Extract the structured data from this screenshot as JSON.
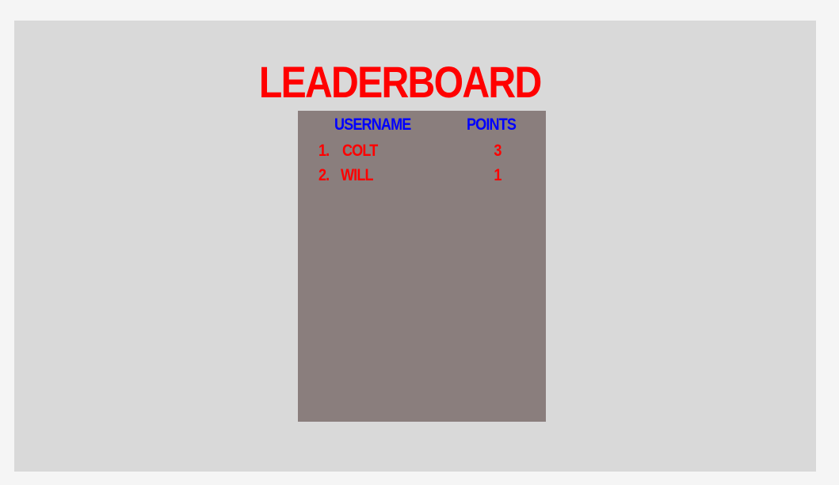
{
  "leaderboard": {
    "title": "LEADERBOARD",
    "columns": {
      "username": "USERNAME",
      "points": "POINTS"
    },
    "rows": [
      {
        "rank": "1.",
        "username": "COLT",
        "points": "3"
      },
      {
        "rank": "2.",
        "username": "WILL",
        "points": "1"
      }
    ]
  },
  "colors": {
    "title": "#ff0000",
    "header": "#0000ff",
    "row_text": "#ff0000",
    "panel": "#8a7e7d",
    "stage": "#d9d9d9",
    "page": "#f5f5f5"
  }
}
